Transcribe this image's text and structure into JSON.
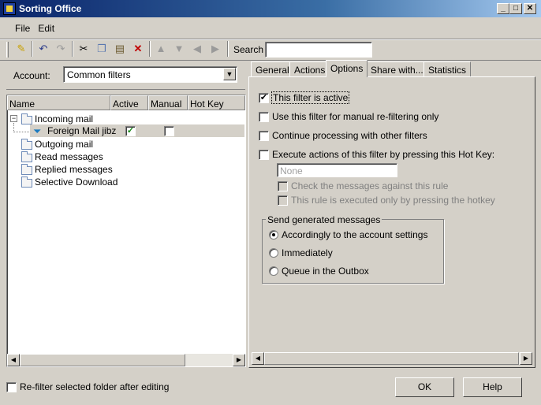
{
  "window": {
    "title": "Sorting Office",
    "minimize": "_",
    "maximize": "□",
    "close": "✕"
  },
  "menu": {
    "file": "File",
    "edit": "Edit"
  },
  "toolbar": {
    "search_label": "Search",
    "search_value": ""
  },
  "account": {
    "label": "Account:",
    "value": "Common filters"
  },
  "columns": {
    "name": "Name",
    "active": "Active",
    "manual": "Manual",
    "hotkey": "Hot Key"
  },
  "tree": {
    "incoming": "Incoming mail",
    "filter": "Foreign Mail jibz",
    "outgoing": "Outgoing mail",
    "read": "Read messages",
    "replied": "Replied messages",
    "selective": "Selective Download"
  },
  "filter_row": {
    "active": true,
    "manual": false
  },
  "tabs": [
    "General",
    "Actions",
    "Options",
    "Share with...",
    "Statistics"
  ],
  "active_tab": "Options",
  "options": {
    "filter_active": {
      "label": "This filter is active",
      "checked": true
    },
    "manual_only": {
      "label": "Use this filter for manual re-filtering only",
      "checked": false
    },
    "continue": {
      "label": "Continue processing with other filters",
      "checked": false
    },
    "hotkey_exec": {
      "label": "Execute actions of this filter by pressing this Hot Key:",
      "checked": false
    },
    "hotkey_value": "None",
    "check_rule": {
      "label": "Check the messages against this rule",
      "checked": false
    },
    "hotkey_only": {
      "label": "This rule is executed only by pressing the hotkey",
      "checked": false
    }
  },
  "send_group": {
    "title": "Send generated messages",
    "options": [
      "Accordingly to the account settings",
      "Immediately",
      "Queue in the Outbox"
    ],
    "selected": 0
  },
  "footer": {
    "refilter_label": "Re-filter selected folder after editing",
    "refilter_checked": false,
    "ok": "OK",
    "help": "Help"
  }
}
